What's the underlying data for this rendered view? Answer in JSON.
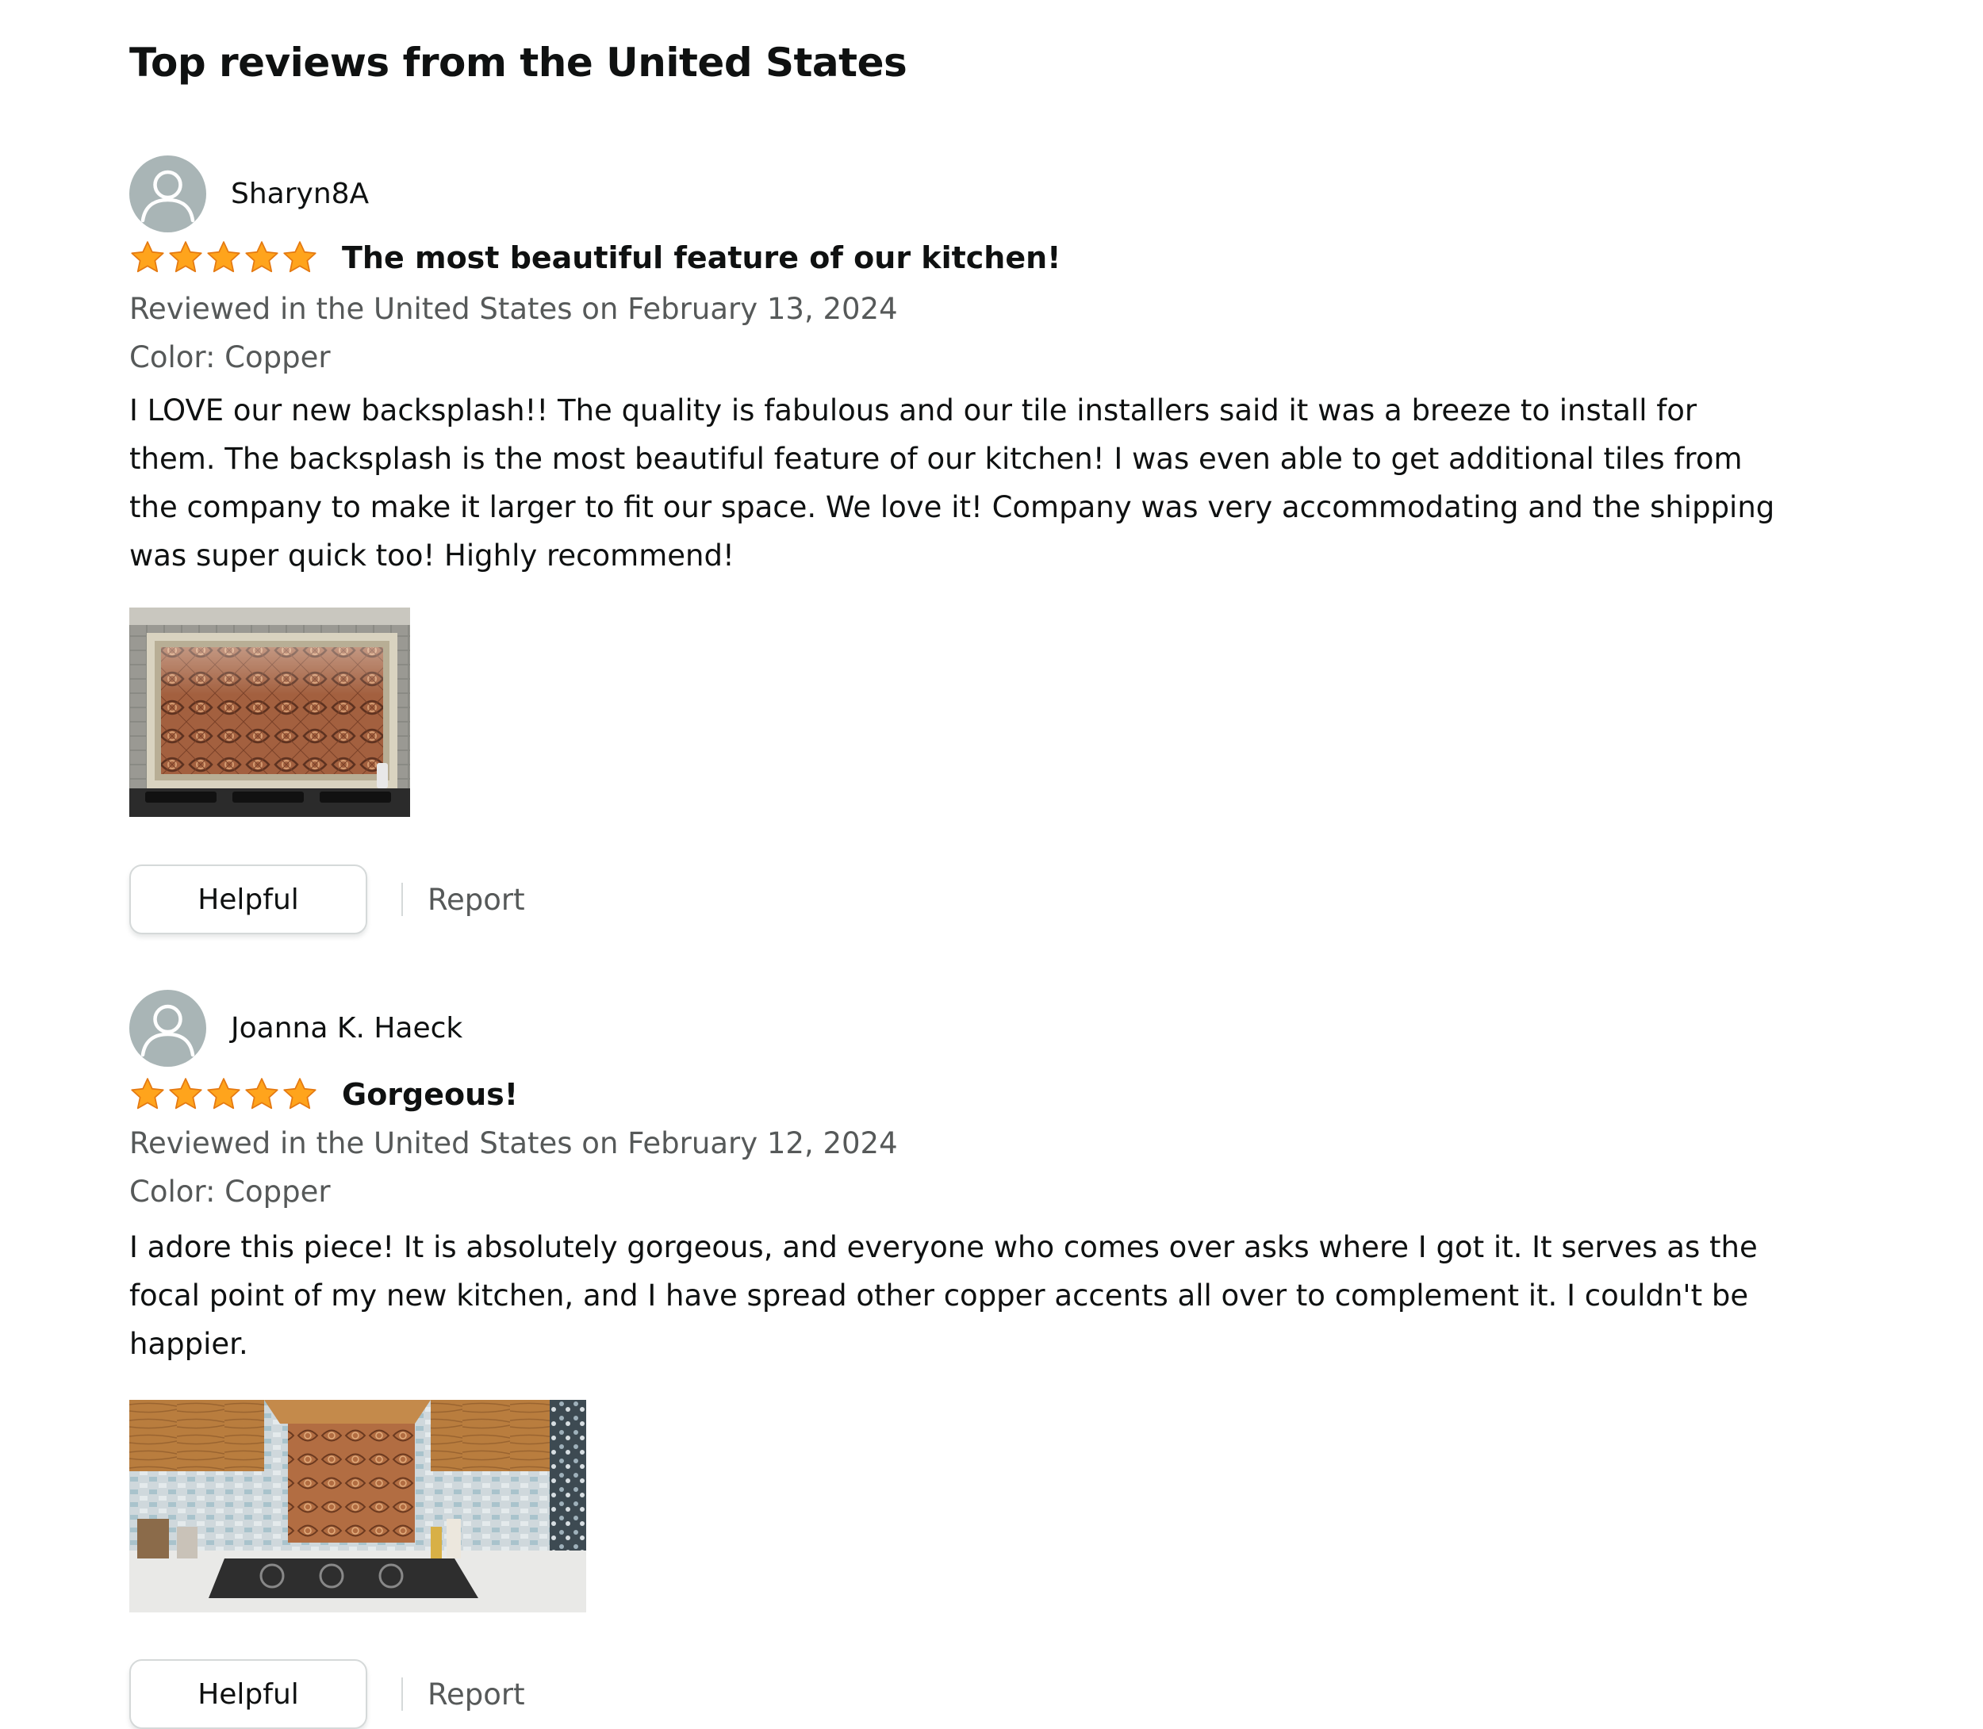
{
  "section": {
    "title": "Top reviews from the United States"
  },
  "colors": {
    "star": "#ffa41c",
    "date_text": "#565959",
    "avatar_bg": "#a9b5b6"
  },
  "reviews": [
    {
      "reviewer": "Sharyn8A",
      "rating": 5,
      "rating_max": 5,
      "title": "The most beautiful feature of our kitchen!",
      "date": "Reviewed in the United States on February 13, 2024",
      "variant": "Color: Copper",
      "body": "I LOVE our new backsplash!! The quality is fabulous and our tile installers said it was a breeze to install for them. The backsplash is the most beautiful feature of our kitchen! I was even able to get additional tiles from the company to make it larger to fit our space. We love it! Company was very accommodating and the shipping was super quick too! Highly recommend!",
      "helpful_label": "Helpful",
      "report_label": "Report"
    },
    {
      "reviewer": "Joanna K. Haeck",
      "rating": 5,
      "rating_max": 5,
      "title": "Gorgeous!",
      "date": "Reviewed in the United States on February 12, 2024",
      "variant": "Color: Copper",
      "body": "I adore this piece! It is absolutely gorgeous, and everyone who comes over asks where I got it. It serves as the focal point of my new kitchen, and I have spread other copper accents all over to complement it. I couldn't be happier.",
      "helpful_label": "Helpful",
      "report_label": "Report"
    }
  ]
}
